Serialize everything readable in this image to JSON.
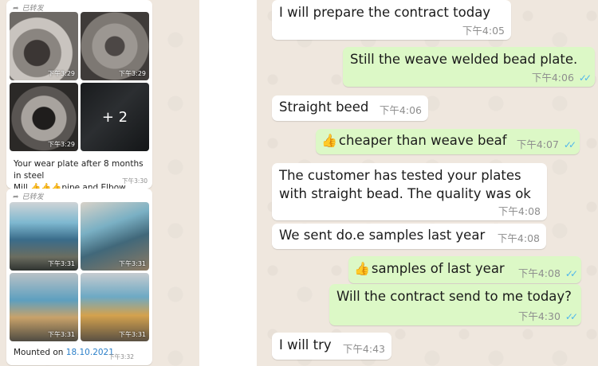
{
  "forward_label": "已转发",
  "left": {
    "group1": {
      "photos": [
        {
          "time": "下午3:29"
        },
        {
          "time": "下午3:29"
        },
        {
          "time": "下午3:29"
        },
        {
          "more": "+ 2"
        }
      ],
      "caption_line1": "Your wear plate after 8 months in steel",
      "caption_line2": "Mill 👍👍👍pipe and Elbow",
      "caption_time": "下午3:30"
    },
    "group2": {
      "photos": [
        {
          "time": "下午3:31"
        },
        {
          "time": "下午3:31"
        },
        {
          "time": "下午3:31"
        },
        {
          "time": "下午3:31"
        }
      ],
      "caption_prefix": "Mounted on ",
      "caption_date": "18.10.2021",
      "caption_time": "下午3:32"
    }
  },
  "messages": [
    {
      "text": "I will prepare the contract today",
      "time": "下午4:05"
    },
    {
      "text": "Still the weave welded bead plate.",
      "time": "下午4:06",
      "ticks": "✓✓"
    },
    {
      "text": "Straight beed",
      "time": "下午4:06"
    },
    {
      "emoji": "👍",
      "text": "cheaper than weave beaf",
      "time": "下午4:07",
      "ticks": "✓✓"
    },
    {
      "line1": "The customer has tested your plates",
      "line2": "with straight bead. The quality was ok",
      "time": "下午4:08"
    },
    {
      "text": "We sent do.e samples last year",
      "time": "下午4:08"
    },
    {
      "emoji": "👍",
      "text": "samples of last year",
      "time": "下午4:08",
      "ticks": "✓✓"
    },
    {
      "text": "Will the contract send to me today?",
      "time": "下午4:30",
      "ticks": "✓✓"
    },
    {
      "text": "I will try",
      "time": "下午4:43"
    }
  ]
}
